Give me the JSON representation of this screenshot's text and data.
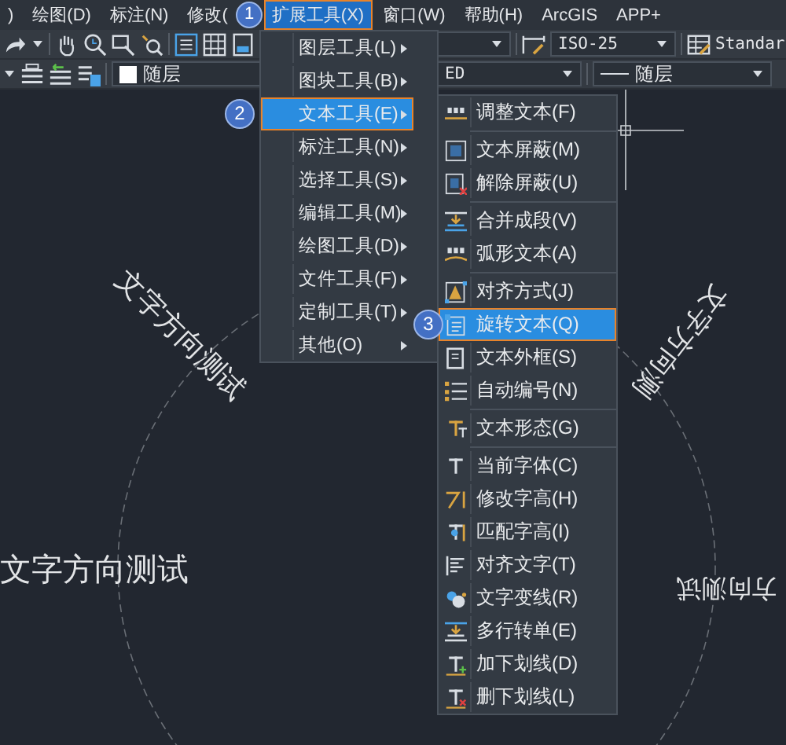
{
  "menubar": {
    "items": [
      {
        "label": ")",
        "selected": false
      },
      {
        "label": "绘图(D)",
        "selected": false
      },
      {
        "label": "标注(N)",
        "selected": false
      },
      {
        "label": "修改(",
        "selected": false
      },
      {
        "label": "扩展工具(X)",
        "selected": true
      },
      {
        "label": "窗口(W)",
        "selected": false
      },
      {
        "label": "帮助(H)",
        "selected": false
      },
      {
        "label": "ArcGIS",
        "selected": false
      },
      {
        "label": "APP+",
        "selected": false
      }
    ]
  },
  "toolbar": {
    "dimension_style": "ISO-25",
    "table_style": "Standar",
    "color_label": "随层",
    "combo_text": "ED",
    "lineweight": "随层"
  },
  "menu": {
    "items": [
      {
        "label": "图层工具(L)",
        "selected": false,
        "has_submenu": true
      },
      {
        "label": "图块工具(B)",
        "selected": false,
        "has_submenu": true
      },
      {
        "label": "文本工具(E)",
        "selected": true,
        "has_submenu": true
      },
      {
        "label": "标注工具(N)",
        "selected": false,
        "has_submenu": true
      },
      {
        "label": "选择工具(S)",
        "selected": false,
        "has_submenu": true
      },
      {
        "label": "编辑工具(M)",
        "selected": false,
        "has_submenu": true
      },
      {
        "label": "绘图工具(D)",
        "selected": false,
        "has_submenu": true
      },
      {
        "label": "文件工具(F)",
        "selected": false,
        "has_submenu": true
      },
      {
        "label": "定制工具(T)",
        "selected": false,
        "has_submenu": true
      },
      {
        "label": "其他(O)",
        "selected": false,
        "has_submenu": true
      }
    ]
  },
  "submenu": {
    "groups": [
      [
        {
          "label": "调整文本(F)",
          "selected": false
        }
      ],
      [
        {
          "label": "文本屏蔽(M)",
          "selected": false
        },
        {
          "label": "解除屏蔽(U)",
          "selected": false
        }
      ],
      [
        {
          "label": "合并成段(V)",
          "selected": false
        },
        {
          "label": "弧形文本(A)",
          "selected": false
        }
      ],
      [
        {
          "label": "对齐方式(J)",
          "selected": false
        },
        {
          "label": "旋转文本(Q)",
          "selected": true
        },
        {
          "label": "文本外框(S)",
          "selected": false
        },
        {
          "label": "自动编号(N)",
          "selected": false
        }
      ],
      [
        {
          "label": "文本形态(G)",
          "selected": false
        }
      ],
      [
        {
          "label": "当前字体(C)",
          "selected": false
        },
        {
          "label": "修改字高(H)",
          "selected": false
        },
        {
          "label": "匹配字高(I)",
          "selected": false
        },
        {
          "label": "对齐文字(T)",
          "selected": false
        },
        {
          "label": "文字变线(R)",
          "selected": false
        },
        {
          "label": "多行转单(E)",
          "selected": false
        },
        {
          "label": "加下划线(D)",
          "selected": false
        },
        {
          "label": "删下划线(L)",
          "selected": false
        }
      ]
    ]
  },
  "step_badges": [
    {
      "label": "1"
    },
    {
      "label": "2"
    },
    {
      "label": "3"
    }
  ],
  "canvas": {
    "texts": [
      {
        "text": "文字方向测试"
      },
      {
        "text": "文字方向测"
      },
      {
        "text": "文字方向测试"
      },
      {
        "text": "方向测试"
      }
    ]
  }
}
